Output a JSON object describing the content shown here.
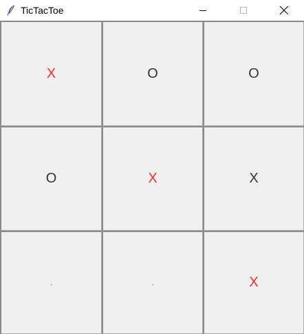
{
  "window": {
    "title": "TicTacToe",
    "icon": "feather-icon",
    "controls": [
      "minimize-icon",
      "maximize-icon",
      "close-icon"
    ]
  },
  "board": {
    "cells": [
      {
        "mark": "X",
        "color": "#ff2a2a"
      },
      {
        "mark": "O",
        "color": "#333333"
      },
      {
        "mark": "O",
        "color": "#333333"
      },
      {
        "mark": "O",
        "color": "#333333"
      },
      {
        "mark": "X",
        "color": "#ff2a2a"
      },
      {
        "mark": "X",
        "color": "#333333"
      },
      {
        "mark": ".",
        "color": "#555555"
      },
      {
        "mark": ".",
        "color": "#555555"
      },
      {
        "mark": "X",
        "color": "#ff2a2a"
      }
    ]
  }
}
